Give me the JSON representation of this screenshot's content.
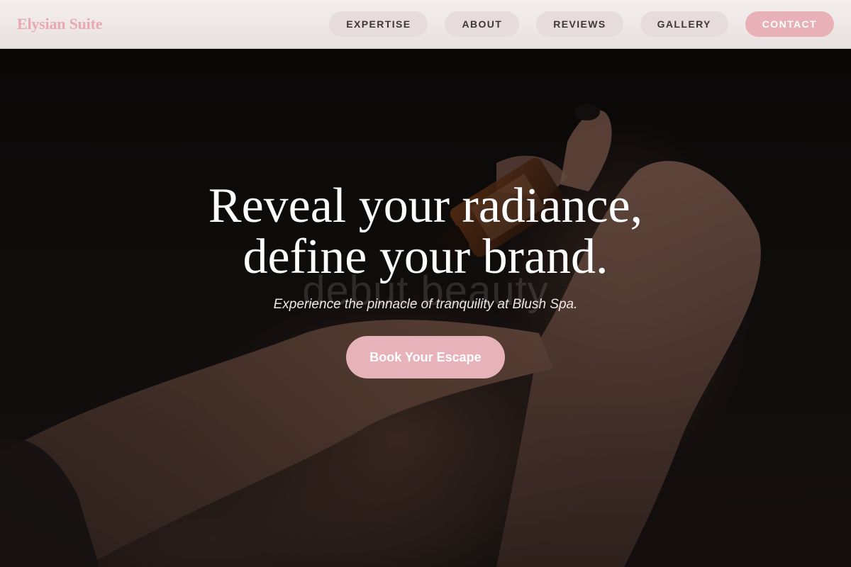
{
  "brand": {
    "name": "Elysian Suite",
    "accent_color": "#e8a9b3",
    "header_bg": "#ece4e3",
    "pill_bg": "#e6dcdc",
    "cta_bg": "#e7b2b9"
  },
  "nav": {
    "items": [
      {
        "label": "EXPERTISE"
      },
      {
        "label": "ABOUT"
      },
      {
        "label": "REVIEWS"
      },
      {
        "label": "GALLERY"
      },
      {
        "label": "CONTACT"
      }
    ]
  },
  "hero": {
    "title_line1": "Reveal your radiance,",
    "title_line2": "define your brand.",
    "subtitle": "Experience the pinnacle of tranquility at Blush Spa.",
    "cta_label": "Book Your Escape",
    "background_image": "hands-holding-essential-oil-bottle",
    "watermark": "debut.beauty"
  }
}
